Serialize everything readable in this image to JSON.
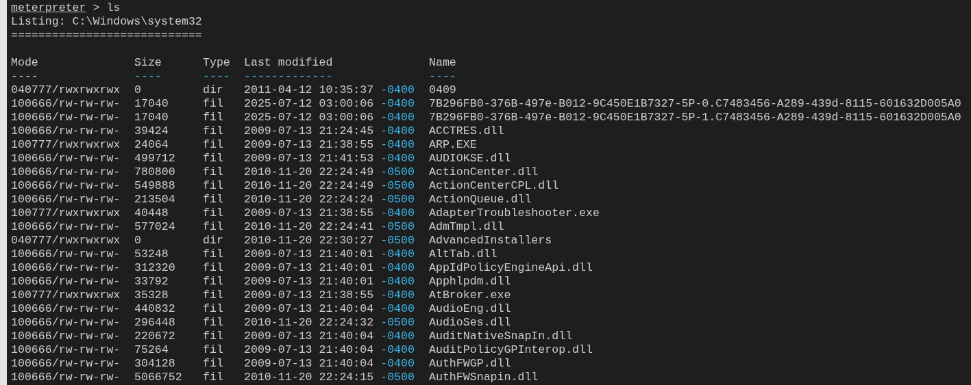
{
  "prompt": {
    "label": "meterpreter",
    "command": "> ls"
  },
  "listing": "Listing: C:\\Windows\\system32",
  "separator": "============================",
  "columns": [
    {
      "label": "Mode",
      "dashes": "----",
      "color": "#cccccc"
    },
    {
      "label": "Size",
      "dashes": "----",
      "color": "#3ab7e8"
    },
    {
      "label": "Type",
      "dashes": "----",
      "color": "#3ab7e8"
    },
    {
      "label": "Last modified",
      "dashes": "-------------",
      "color": "#3ab7e8"
    },
    {
      "label": "Name",
      "dashes": "----",
      "color": "#3ab7e8"
    }
  ],
  "rows": [
    {
      "mode": "040777/rwxrwxrwx",
      "size": "0",
      "type": "dir",
      "modified": "2011-04-12 10:35:37",
      "tz": "-0400",
      "name": "0409"
    },
    {
      "mode": "100666/rw-rw-rw-",
      "size": "17040",
      "type": "fil",
      "modified": "2025-07-12 03:00:06",
      "tz": "-0400",
      "name": "7B296FB0-376B-497e-B012-9C450E1B7327-5P-0.C7483456-A289-439d-8115-601632D005A0"
    },
    {
      "mode": "100666/rw-rw-rw-",
      "size": "17040",
      "type": "fil",
      "modified": "2025-07-12 03:00:06",
      "tz": "-0400",
      "name": "7B296FB0-376B-497e-B012-9C450E1B7327-5P-1.C7483456-A289-439d-8115-601632D005A0"
    },
    {
      "mode": "100666/rw-rw-rw-",
      "size": "39424",
      "type": "fil",
      "modified": "2009-07-13 21:24:45",
      "tz": "-0400",
      "name": "ACCTRES.dll"
    },
    {
      "mode": "100777/rwxrwxrwx",
      "size": "24064",
      "type": "fil",
      "modified": "2009-07-13 21:38:55",
      "tz": "-0400",
      "name": "ARP.EXE"
    },
    {
      "mode": "100666/rw-rw-rw-",
      "size": "499712",
      "type": "fil",
      "modified": "2009-07-13 21:41:53",
      "tz": "-0400",
      "name": "AUDIOKSE.dll"
    },
    {
      "mode": "100666/rw-rw-rw-",
      "size": "780800",
      "type": "fil",
      "modified": "2010-11-20 22:24:49",
      "tz": "-0500",
      "name": "ActionCenter.dll"
    },
    {
      "mode": "100666/rw-rw-rw-",
      "size": "549888",
      "type": "fil",
      "modified": "2010-11-20 22:24:49",
      "tz": "-0500",
      "name": "ActionCenterCPL.dll"
    },
    {
      "mode": "100666/rw-rw-rw-",
      "size": "213504",
      "type": "fil",
      "modified": "2010-11-20 22:24:24",
      "tz": "-0500",
      "name": "ActionQueue.dll"
    },
    {
      "mode": "100777/rwxrwxrwx",
      "size": "40448",
      "type": "fil",
      "modified": "2009-07-13 21:38:55",
      "tz": "-0400",
      "name": "AdapterTroubleshooter.exe"
    },
    {
      "mode": "100666/rw-rw-rw-",
      "size": "577024",
      "type": "fil",
      "modified": "2010-11-20 22:24:41",
      "tz": "-0500",
      "name": "AdmTmpl.dll"
    },
    {
      "mode": "040777/rwxrwxrwx",
      "size": "0",
      "type": "dir",
      "modified": "2010-11-20 22:30:27",
      "tz": "-0500",
      "name": "AdvancedInstallers"
    },
    {
      "mode": "100666/rw-rw-rw-",
      "size": "53248",
      "type": "fil",
      "modified": "2009-07-13 21:40:01",
      "tz": "-0400",
      "name": "AltTab.dll"
    },
    {
      "mode": "100666/rw-rw-rw-",
      "size": "312320",
      "type": "fil",
      "modified": "2009-07-13 21:40:01",
      "tz": "-0400",
      "name": "AppIdPolicyEngineApi.dll"
    },
    {
      "mode": "100666/rw-rw-rw-",
      "size": "33792",
      "type": "fil",
      "modified": "2009-07-13 21:40:01",
      "tz": "-0400",
      "name": "Apphlpdm.dll"
    },
    {
      "mode": "100777/rwxrwxrwx",
      "size": "35328",
      "type": "fil",
      "modified": "2009-07-13 21:38:55",
      "tz": "-0400",
      "name": "AtBroker.exe"
    },
    {
      "mode": "100666/rw-rw-rw-",
      "size": "440832",
      "type": "fil",
      "modified": "2009-07-13 21:40:04",
      "tz": "-0400",
      "name": "AudioEng.dll"
    },
    {
      "mode": "100666/rw-rw-rw-",
      "size": "296448",
      "type": "fil",
      "modified": "2010-11-20 22:24:32",
      "tz": "-0500",
      "name": "AudioSes.dll"
    },
    {
      "mode": "100666/rw-rw-rw-",
      "size": "220672",
      "type": "fil",
      "modified": "2009-07-13 21:40:04",
      "tz": "-0400",
      "name": "AuditNativeSnapIn.dll"
    },
    {
      "mode": "100666/rw-rw-rw-",
      "size": "75264",
      "type": "fil",
      "modified": "2009-07-13 21:40:04",
      "tz": "-0400",
      "name": "AuditPolicyGPInterop.dll"
    },
    {
      "mode": "100666/rw-rw-rw-",
      "size": "304128",
      "type": "fil",
      "modified": "2009-07-13 21:40:04",
      "tz": "-0400",
      "name": "AuthFWGP.dll"
    },
    {
      "mode": "100666/rw-rw-rw-",
      "size": "5066752",
      "type": "fil",
      "modified": "2010-11-20 22:24:15",
      "tz": "-0500",
      "name": "AuthFWSnapin.dll"
    }
  ]
}
